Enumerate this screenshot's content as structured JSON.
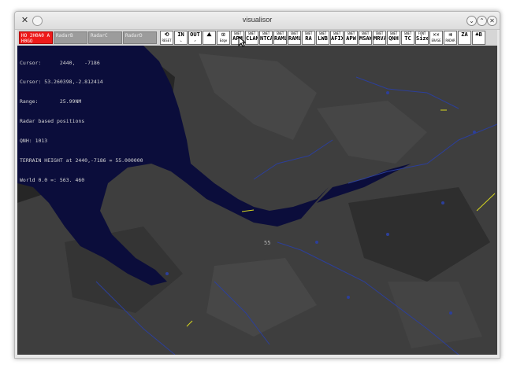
{
  "window": {
    "title": "visualisor"
  },
  "toolbar": {
    "radar_tabs": [
      {
        "label": "HO 2H0A0 A\nH0GO",
        "active": true
      },
      {
        "label": "RadarB",
        "active": false
      },
      {
        "label": "RadarC",
        "active": false
      },
      {
        "label": "RadarD",
        "active": false
      }
    ],
    "tools": [
      {
        "top": "⟲",
        "bottom": "RESET",
        "icon": "reset-icon"
      },
      {
        "top": "IN",
        "bottom": "↘",
        "icon": "zoom-in-icon"
      },
      {
        "top": "OUT",
        "bottom": "↗",
        "icon": "zoom-out-icon"
      },
      {
        "top": "⛰",
        "bottom": "",
        "icon": "terrain-icon"
      },
      {
        "top": "⊡",
        "bottom": "Edge",
        "icon": "edge-icon"
      },
      {
        "top": "SNET",
        "bottom": "APM"
      },
      {
        "top": "SNET",
        "bottom": "CLAM"
      },
      {
        "top": "SNET",
        "bottom": "NTCA"
      },
      {
        "top": "SNET",
        "bottom": "RAMLD"
      },
      {
        "top": "SNET",
        "bottom": "RAMLO"
      },
      {
        "top": "SNET",
        "bottom": "RA"
      },
      {
        "top": "SNET",
        "bottom": "LWB"
      },
      {
        "top": "SNET",
        "bottom": "AFIX"
      },
      {
        "top": "SNET",
        "bottom": "APW"
      },
      {
        "top": "SNET",
        "bottom": "MSAW"
      },
      {
        "top": "SNET",
        "bottom": "MRVA"
      },
      {
        "top": "SNET",
        "bottom": "QNH"
      },
      {
        "top": "SNET",
        "bottom": "TC"
      },
      {
        "top": "FONT",
        "bottom": "Size"
      },
      {
        "top": "✕✕",
        "bottom": "ERASE",
        "icon": "erase-icon"
      },
      {
        "top": "⇉",
        "bottom": "RADAR",
        "icon": "radar-icon"
      },
      {
        "top": "ZA",
        "bottom": "",
        "icon": "za-icon"
      },
      {
        "top": "♣B",
        "bottom": "",
        "icon": "tree-icon"
      }
    ]
  },
  "info": {
    "lines": [
      "Cursor:      2440,   -7186",
      "Cursor: 53.260398,-2.812414",
      "Range:       25.99NM",
      "Radar based positions",
      "QNH: 1013",
      "TERRAIN HEIGHT at 2440,-7186 = 55.000000",
      "World 0.0 =: 563. 460"
    ]
  },
  "map": {
    "center_label": "55",
    "colors": {
      "background": "#262626",
      "terrain": "#3e3e3e",
      "water": "#0b0d3b",
      "rivers": "#2c3f9a",
      "traffic": "#d8d820"
    }
  }
}
